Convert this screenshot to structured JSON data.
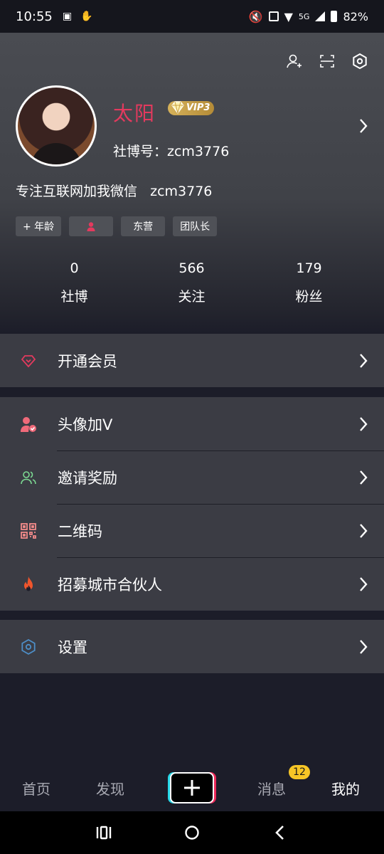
{
  "status_bar": {
    "time": "10:55",
    "network": "5G",
    "battery": "82%"
  },
  "profile": {
    "name": "太阳",
    "vip_label": "VIP3",
    "social_id": "社博号：zcm3776",
    "bio": "专注互联网加我微信   zcm3776",
    "tags": [
      "+ 年龄",
      "东营",
      "团队长"
    ]
  },
  "stats": [
    {
      "value": "0",
      "label": "社博"
    },
    {
      "value": "566",
      "label": "关注"
    },
    {
      "value": "179",
      "label": "粉丝"
    }
  ],
  "menu": {
    "membership": "开通会员",
    "avatar_v": "头像加V",
    "invite_rewards": "邀请奖励",
    "qr_code": "二维码",
    "city_partner": "招募城市合伙人",
    "settings": "设置"
  },
  "bottom_nav": {
    "home": "首页",
    "discover": "发现",
    "messages": "消息",
    "messages_badge": "12",
    "mine": "我的"
  },
  "colors": {
    "accent_pink": "#e33a5e",
    "badge_yellow": "#f7c626",
    "vip_gold": "#d6b25a",
    "background": "#1c1d29"
  }
}
